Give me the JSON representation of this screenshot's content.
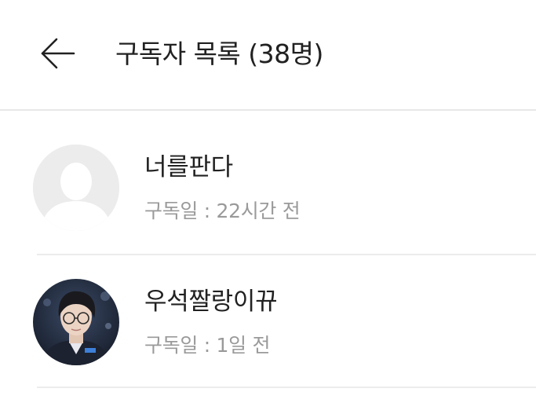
{
  "header": {
    "back_icon": "arrow-left-icon",
    "title": "구독자 목록 (38명)"
  },
  "subscribers": [
    {
      "name": "너를판다",
      "subscribed": "구독일 : 22시간 전",
      "avatar": "default-user-silhouette-icon"
    },
    {
      "name": "우석짤랑이뀨",
      "subscribed": "구독일 : 1일 전",
      "avatar": "profile-photo"
    }
  ],
  "colors": {
    "title_text": "#212121",
    "secondary_text": "#9a9a9a",
    "divider": "#ececec",
    "avatar_placeholder": "#ececec"
  }
}
